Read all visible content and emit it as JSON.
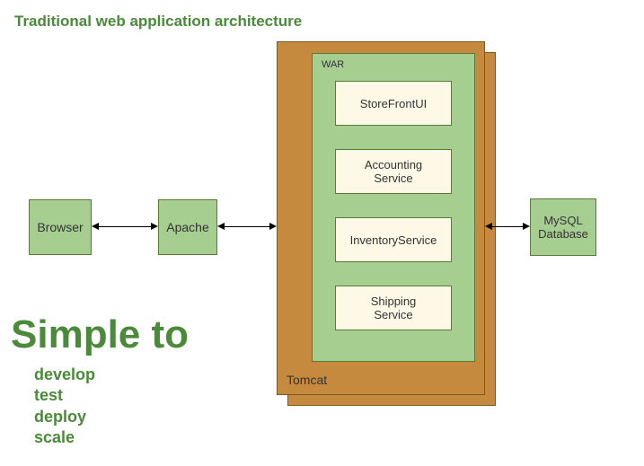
{
  "title": "Traditional web application architecture",
  "nodes": {
    "browser": "Browser",
    "apache": "Apache",
    "mysql": "MySQL\nDatabase",
    "tomcat": "Tomcat",
    "war": "WAR",
    "services": [
      "StoreFrontUI",
      "Accounting\nService",
      "InventoryService",
      "Shipping\nService"
    ]
  },
  "heading": "Simple to",
  "bullets": [
    "develop",
    "test",
    "deploy",
    "scale"
  ],
  "colors": {
    "green_text": "#4a8a3a",
    "green_box": "#a6ce90",
    "orange_box": "#c58a3e",
    "cream_box": "#fdf9e6"
  }
}
